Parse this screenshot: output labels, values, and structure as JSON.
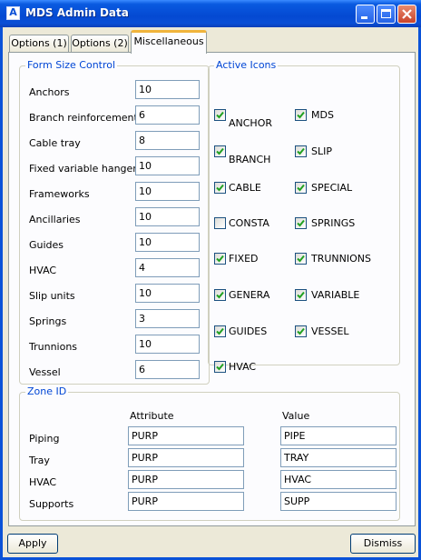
{
  "window": {
    "title": "MDS Admin Data",
    "app_icon_glyph": "A"
  },
  "tabs": [
    {
      "label": "Options (1)"
    },
    {
      "label": "Options (2)"
    },
    {
      "label": "Miscellaneous",
      "active": true
    }
  ],
  "form_size_control": {
    "title": "Form Size Control",
    "rows": [
      {
        "label": "Anchors",
        "value": "10"
      },
      {
        "label": "Branch reinforcements",
        "value": "6"
      },
      {
        "label": "Cable tray",
        "value": "8"
      },
      {
        "label": "Fixed  variable hangers",
        "value": "10"
      },
      {
        "label": "Frameworks",
        "value": "10"
      },
      {
        "label": "Ancillaries",
        "value": "10"
      },
      {
        "label": "Guides",
        "value": "10"
      },
      {
        "label": "HVAC",
        "value": "4"
      },
      {
        "label": "Slip units",
        "value": "10"
      },
      {
        "label": "Springs",
        "value": "3"
      },
      {
        "label": "Trunnions",
        "value": "10"
      },
      {
        "label": "Vessel",
        "value": "6"
      }
    ]
  },
  "active_icons": {
    "title": "Active Icons",
    "items": [
      {
        "label": "ANCHOR",
        "checked": true
      },
      {
        "label": "MDS",
        "checked": true
      },
      {
        "label": "BRANCH",
        "checked": true
      },
      {
        "label": "SLIP",
        "checked": true
      },
      {
        "label": "CABLE",
        "checked": true
      },
      {
        "label": "SPECIAL",
        "checked": true
      },
      {
        "label": "CONSTA",
        "checked": false
      },
      {
        "label": "SPRINGS",
        "checked": true
      },
      {
        "label": "FIXED",
        "checked": true
      },
      {
        "label": "TRUNNIONS",
        "checked": true
      },
      {
        "label": "GENERA",
        "checked": true
      },
      {
        "label": "VARIABLE",
        "checked": true
      },
      {
        "label": "GUIDES",
        "checked": true
      },
      {
        "label": "VESSEL",
        "checked": true
      },
      {
        "label": "HVAC",
        "checked": true
      }
    ]
  },
  "zone_id": {
    "title": "Zone ID",
    "attribute_header": "Attribute",
    "value_header": "Value",
    "rows": [
      {
        "label": "Piping",
        "attribute": "PURP",
        "value": "PIPE"
      },
      {
        "label": "Tray",
        "attribute": "PURP",
        "value": "TRAY"
      },
      {
        "label": "HVAC",
        "attribute": "PURP",
        "value": "HVAC"
      },
      {
        "label": "Supports",
        "attribute": "PURP",
        "value": "SUPP"
      }
    ]
  },
  "buttons": {
    "apply": "Apply",
    "dismiss": "Dismiss"
  },
  "colors": {
    "title_bar": "#0a4fd6",
    "group_title": "#0046d5",
    "tab_highlight": "#f0b43c",
    "check": "#21a121"
  }
}
